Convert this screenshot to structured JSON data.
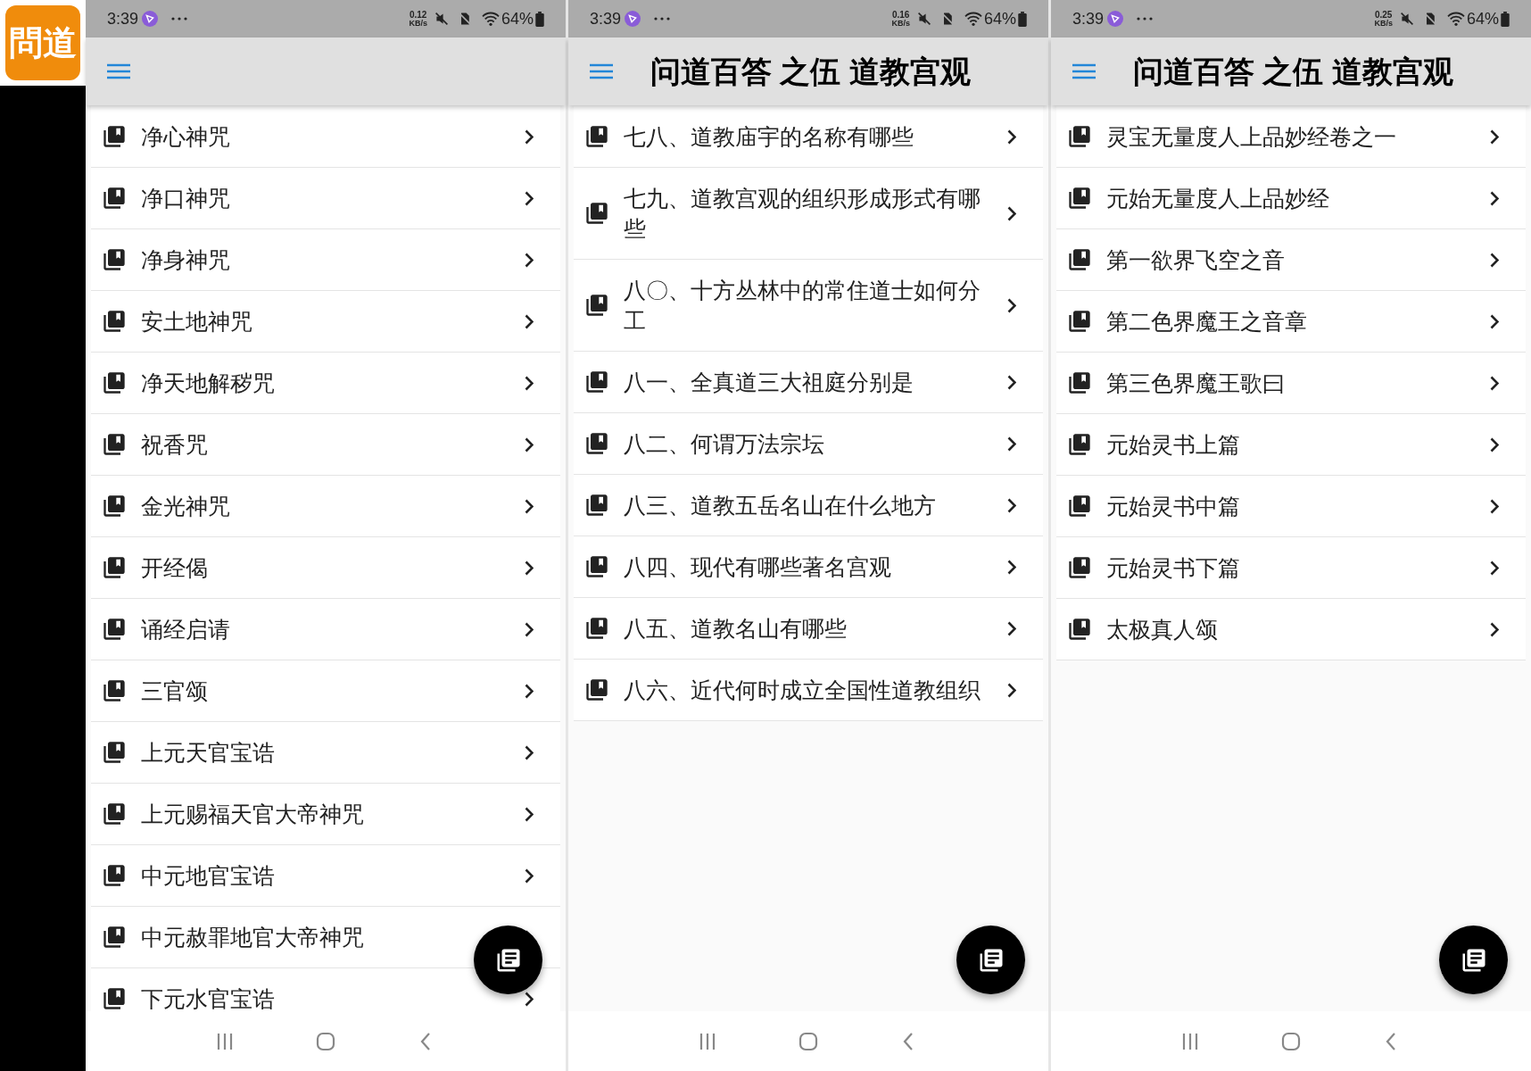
{
  "app_icon": {
    "label": "問道"
  },
  "phones": [
    {
      "status_bar": {
        "time": "3:39",
        "speed_value": "0.12",
        "speed_unit": "KB/s",
        "battery": "64%"
      },
      "items": [
        {
          "label": "净心神咒"
        },
        {
          "label": "净口神咒"
        },
        {
          "label": "净身神咒"
        },
        {
          "label": "安土地神咒"
        },
        {
          "label": "净天地解秽咒"
        },
        {
          "label": "祝香咒"
        },
        {
          "label": "金光神咒"
        },
        {
          "label": "开经偈"
        },
        {
          "label": "诵经启请"
        },
        {
          "label": "三官颂"
        },
        {
          "label": "上元天官宝诰"
        },
        {
          "label": "上元赐福天官大帝神咒"
        },
        {
          "label": "中元地官宝诰"
        },
        {
          "label": "中元赦罪地官大帝神咒"
        },
        {
          "label": "下元水官宝诰"
        }
      ]
    },
    {
      "status_bar": {
        "time": "3:39",
        "speed_value": "0.16",
        "speed_unit": "KB/s",
        "battery": "64%"
      },
      "toolbar": {
        "title": "问道百答 之伍 道教宫观"
      },
      "items": [
        {
          "label": "七八、道教庙宇的名称有哪些"
        },
        {
          "label": "七九、道教宫观的组织形成形式有哪些"
        },
        {
          "label": "八〇、十方丛林中的常住道士如何分工"
        },
        {
          "label": "八一、全真道三大祖庭分别是"
        },
        {
          "label": "八二、何谓万法宗坛"
        },
        {
          "label": "八三、道教五岳名山在什么地方"
        },
        {
          "label": "八四、现代有哪些著名宫观"
        },
        {
          "label": "八五、道教名山有哪些"
        },
        {
          "label": "八六、近代何时成立全国性道教组织"
        }
      ]
    },
    {
      "status_bar": {
        "time": "3:39",
        "speed_value": "0.25",
        "speed_unit": "KB/s",
        "battery": "64%"
      },
      "toolbar": {
        "title": "问道百答 之伍 道教宫观"
      },
      "items": [
        {
          "label": "灵宝无量度人上品妙经卷之一"
        },
        {
          "label": "元始无量度人上品妙经"
        },
        {
          "label": "第一欲界飞空之音"
        },
        {
          "label": "第二色界魔王之音章"
        },
        {
          "label": "第三色界魔王歌曰"
        },
        {
          "label": "元始灵书上篇"
        },
        {
          "label": "元始灵书中篇"
        },
        {
          "label": "元始灵书下篇"
        },
        {
          "label": "太极真人颂"
        }
      ]
    }
  ]
}
